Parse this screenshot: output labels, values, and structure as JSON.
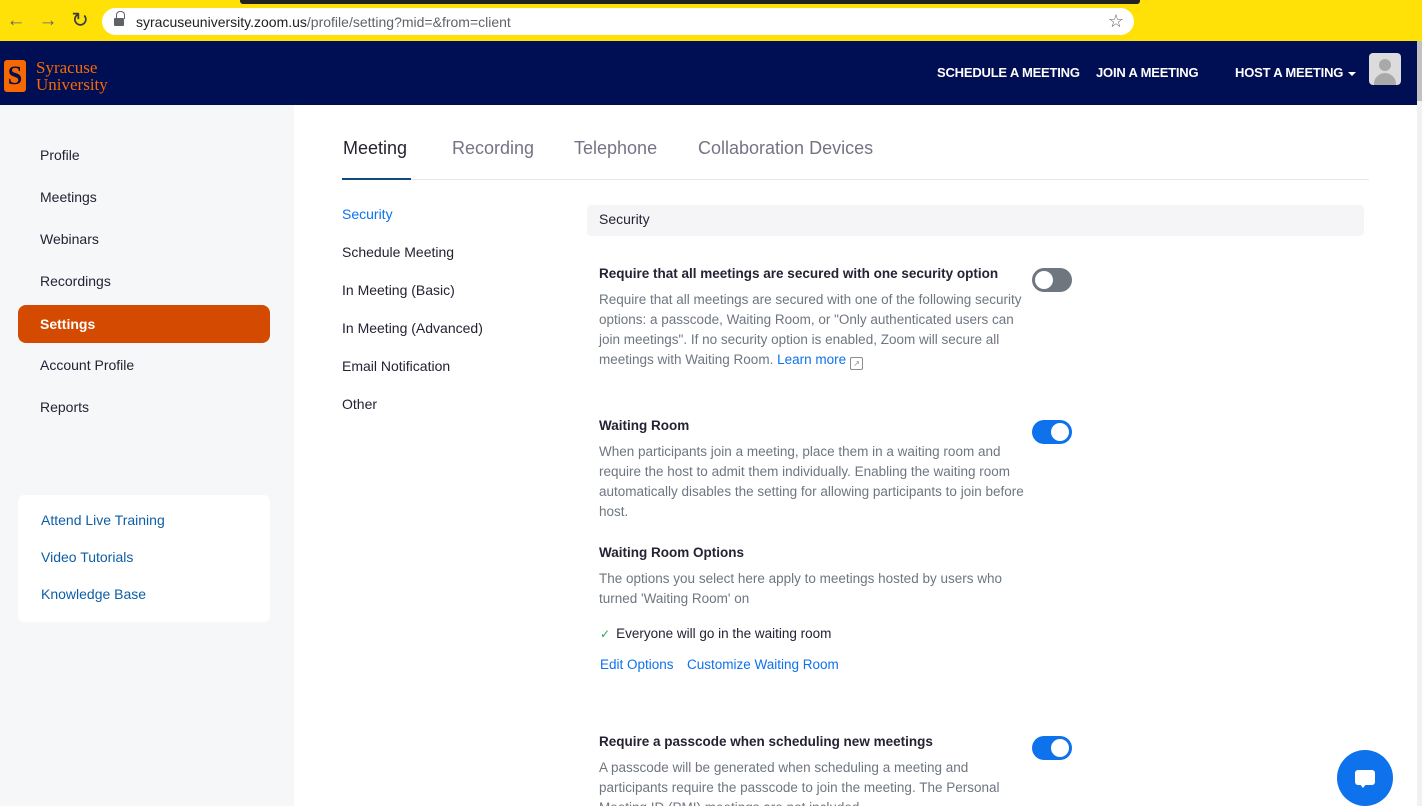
{
  "browser": {
    "url_host": "syracuseuniversity.zoom.us",
    "url_path": "/profile/setting?mid=&from=client"
  },
  "header": {
    "logo_letter": "S",
    "logo_line1": "Syracuse",
    "logo_line2": "University",
    "schedule": "SCHEDULE A MEETING",
    "join": "JOIN A MEETING",
    "host": "HOST A MEETING"
  },
  "sidebar": {
    "items": [
      {
        "label": "Profile"
      },
      {
        "label": "Meetings"
      },
      {
        "label": "Webinars"
      },
      {
        "label": "Recordings"
      },
      {
        "label": "Settings"
      },
      {
        "label": "Account Profile"
      },
      {
        "label": "Reports"
      }
    ],
    "active_index": 4,
    "help_links": [
      {
        "label": "Attend Live Training"
      },
      {
        "label": "Video Tutorials"
      },
      {
        "label": "Knowledge Base"
      }
    ]
  },
  "tabs": [
    {
      "label": "Meeting"
    },
    {
      "label": "Recording"
    },
    {
      "label": "Telephone"
    },
    {
      "label": "Collaboration Devices"
    }
  ],
  "subnav": [
    {
      "label": "Security"
    },
    {
      "label": "Schedule Meeting"
    },
    {
      "label": "In Meeting (Basic)"
    },
    {
      "label": "In Meeting (Advanced)"
    },
    {
      "label": "Email Notification"
    },
    {
      "label": "Other"
    }
  ],
  "section_title": "Security",
  "settings": {
    "secure_option": {
      "title": "Require that all meetings are secured with one security option",
      "desc": "Require that all meetings are secured with one of the following security options: a passcode, Waiting Room, or \"Only authenticated users can join meetings\". If no security option is enabled, Zoom will secure all meetings with Waiting Room.",
      "learn_more": "Learn more",
      "enabled": false
    },
    "waiting_room": {
      "title": "Waiting Room",
      "desc": "When participants join a meeting, place them in a waiting room and require the host to admit them individually. Enabling the waiting room automatically disables the setting for allowing participants to join before host.",
      "enabled": true
    },
    "waiting_room_options": {
      "title": "Waiting Room Options",
      "desc": "The options you select here apply to meetings hosted by users who turned 'Waiting Room' on",
      "selected": "Everyone will go in the waiting room",
      "edit": "Edit Options",
      "customize": "Customize Waiting Room"
    },
    "passcode": {
      "title": "Require a passcode when scheduling new meetings",
      "desc": "A passcode will be generated when scheduling a meeting and participants require the passcode to join the meeting. The Personal Meeting ID (PMI) meetings are not included.",
      "enabled": true
    }
  }
}
